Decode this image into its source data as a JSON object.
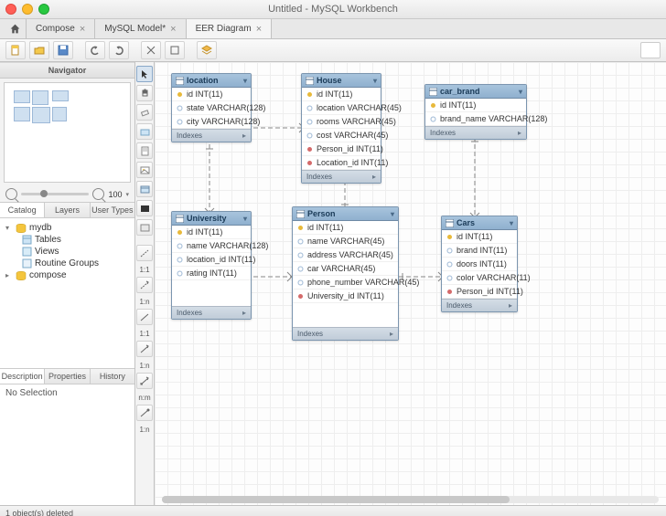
{
  "window": {
    "title": "Untitled - MySQL Workbench"
  },
  "tabs": [
    {
      "label": "Compose"
    },
    {
      "label": "MySQL Model*"
    },
    {
      "label": "EER Diagram"
    }
  ],
  "active_tab": 2,
  "sidebar": {
    "nav_header": "Navigator",
    "zoom_value": "100",
    "subtabs": [
      "Catalog",
      "Layers",
      "User Types"
    ],
    "active_subtab": 0,
    "tree": {
      "db": "mydb",
      "children": [
        "Tables",
        "Views",
        "Routine Groups"
      ],
      "sibling": "compose"
    },
    "prop_tabs": [
      "Description",
      "Properties",
      "History"
    ],
    "no_selection": "No Selection"
  },
  "vtools": {
    "labels": [
      "1:1",
      "1:n",
      "1:1",
      "1:n",
      "n:m",
      "1:n"
    ]
  },
  "entities": {
    "location": {
      "name": "location",
      "cols": [
        {
          "k": "pk",
          "t": "id INT(11)"
        },
        {
          "k": "a",
          "t": "state VARCHAR(128)"
        },
        {
          "k": "a",
          "t": "city VARCHAR(128)"
        }
      ],
      "idx": "Indexes"
    },
    "house": {
      "name": "House",
      "cols": [
        {
          "k": "pk",
          "t": "id INT(11)"
        },
        {
          "k": "a",
          "t": "location VARCHAR(45)"
        },
        {
          "k": "a",
          "t": "rooms VARCHAR(45)"
        },
        {
          "k": "a",
          "t": "cost VARCHAR(45)"
        },
        {
          "k": "fk",
          "t": "Person_id INT(11)"
        },
        {
          "k": "fk",
          "t": "Location_id INT(11)"
        }
      ],
      "idx": "Indexes"
    },
    "car_brand": {
      "name": "car_brand",
      "cols": [
        {
          "k": "pk",
          "t": "id INT(11)"
        },
        {
          "k": "a",
          "t": "brand_name VARCHAR(128)"
        }
      ],
      "idx": "Indexes"
    },
    "university": {
      "name": "University",
      "cols": [
        {
          "k": "pk",
          "t": "id INT(11)"
        },
        {
          "k": "a",
          "t": "name VARCHAR(128)"
        },
        {
          "k": "a",
          "t": "location_id INT(11)"
        },
        {
          "k": "a",
          "t": "rating INT(11)"
        }
      ],
      "idx": "Indexes"
    },
    "person": {
      "name": "Person",
      "cols": [
        {
          "k": "pk",
          "t": "id INT(11)"
        },
        {
          "k": "a",
          "t": "name VARCHAR(45)"
        },
        {
          "k": "a",
          "t": "address VARCHAR(45)"
        },
        {
          "k": "a",
          "t": "car VARCHAR(45)"
        },
        {
          "k": "a",
          "t": "phone_number VARCHAR(45)"
        },
        {
          "k": "fk",
          "t": "University_id INT(11)"
        }
      ],
      "idx": "Indexes"
    },
    "cars": {
      "name": "Cars",
      "cols": [
        {
          "k": "pk",
          "t": "id INT(11)"
        },
        {
          "k": "a",
          "t": "brand INT(11)"
        },
        {
          "k": "a",
          "t": "doors INT(11)"
        },
        {
          "k": "a",
          "t": "color VARCHAR(11)"
        },
        {
          "k": "fk",
          "t": "Person_id INT(11)"
        }
      ],
      "idx": "Indexes"
    }
  },
  "statusbar": {
    "text": "1 object(s) deleted"
  }
}
